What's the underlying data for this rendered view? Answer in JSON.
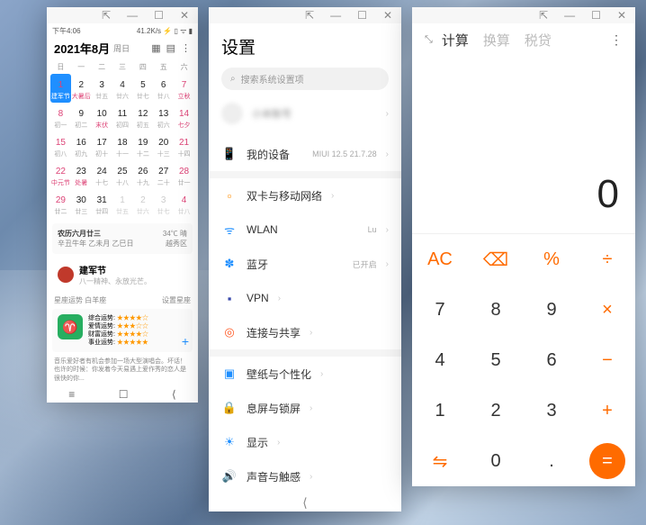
{
  "titlebar": {
    "pin": "⇱",
    "min": "—",
    "max": "☐",
    "close": "✕"
  },
  "calendar": {
    "status": {
      "time": "下午4:06",
      "signal": "41.2K/s ⚡ ▯ ᯤ ▮"
    },
    "title": "2021年8月",
    "sub": "周日",
    "dows": [
      "日",
      "一",
      "二",
      "三",
      "四",
      "五",
      "六"
    ],
    "days": [
      {
        "d": 1,
        "l": "建军节",
        "sel": true
      },
      {
        "d": 2,
        "l": "大暑后",
        "hol": true
      },
      {
        "d": 3,
        "l": "廿五"
      },
      {
        "d": 4,
        "l": "廿六"
      },
      {
        "d": 5,
        "l": "廿七"
      },
      {
        "d": 6,
        "l": "廿八"
      },
      {
        "d": 7,
        "l": "立秋",
        "hol": true
      },
      {
        "d": 8,
        "l": "初一"
      },
      {
        "d": 9,
        "l": "初二"
      },
      {
        "d": 10,
        "l": "末伏",
        "hol": true
      },
      {
        "d": 11,
        "l": "初四"
      },
      {
        "d": 12,
        "l": "初五"
      },
      {
        "d": 13,
        "l": "初六"
      },
      {
        "d": 14,
        "l": "七夕",
        "hol": true
      },
      {
        "d": 15,
        "l": "初八"
      },
      {
        "d": 16,
        "l": "初九"
      },
      {
        "d": 17,
        "l": "初十"
      },
      {
        "d": 18,
        "l": "十一"
      },
      {
        "d": 19,
        "l": "十二"
      },
      {
        "d": 20,
        "l": "十三"
      },
      {
        "d": 21,
        "l": "十四"
      },
      {
        "d": 22,
        "l": "中元节",
        "hol": true
      },
      {
        "d": 23,
        "l": "处暑",
        "hol": true
      },
      {
        "d": 24,
        "l": "十七"
      },
      {
        "d": 25,
        "l": "十八"
      },
      {
        "d": 26,
        "l": "十九"
      },
      {
        "d": 27,
        "l": "二十"
      },
      {
        "d": 28,
        "l": "廿一"
      },
      {
        "d": 29,
        "l": "廿二"
      },
      {
        "d": 30,
        "l": "廿三"
      },
      {
        "d": 31,
        "l": "廿四"
      },
      {
        "d": 1,
        "l": "廿五",
        "off": true
      },
      {
        "d": 2,
        "l": "廿六",
        "off": true
      },
      {
        "d": 3,
        "l": "廿七",
        "off": true
      },
      {
        "d": 4,
        "l": "廿八",
        "off": true
      }
    ],
    "info": {
      "lunar": "农历六月廿三",
      "line2": "辛丑牛年 乙未月 乙巳日",
      "temp": "34℃ 晴",
      "loc": "越秀区"
    },
    "festival": {
      "name": "建军节",
      "desc": "八一精神、永放光芒。"
    },
    "horoscope": {
      "header": "星座运势",
      "header2": "白羊座",
      "btn": "设置星座",
      "zodiac": "♈",
      "rows": [
        {
          "k": "综合运势:",
          "v": "★★★★☆"
        },
        {
          "k": "爱情运势:",
          "v": "★★★☆☆"
        },
        {
          "k": "财富运势:",
          "v": "★★★★☆"
        },
        {
          "k": "事业运势:",
          "v": "★★★★★"
        }
      ],
      "desc": "音乐爱好者有机会参加一场大型演唱会。坏话！也许的时候：你发着今天易遇上爱作秀的恋人是很快的你..."
    }
  },
  "settings": {
    "title": "设置",
    "search_ph": "搜索系统设置项",
    "user": "小米账号",
    "items": [
      {
        "ico": "📱",
        "c": "#1f8fff",
        "name": "我的设备",
        "val": "MIUI 12.5 21.7.28"
      },
      null,
      {
        "ico": "▫",
        "c": "#ff8c00",
        "name": "双卡与移动网络"
      },
      {
        "ico": "ᯤ",
        "c": "#1f8fff",
        "name": "WLAN",
        "val": "Lu"
      },
      {
        "ico": "✽",
        "c": "#1f8fff",
        "name": "蓝牙",
        "val": "已开启"
      },
      {
        "ico": "▪",
        "c": "#3949ab",
        "name": "VPN"
      },
      {
        "ico": "◎",
        "c": "#ff5722",
        "name": "连接与共享"
      },
      null,
      {
        "ico": "▣",
        "c": "#1f8fff",
        "name": "壁纸与个性化"
      },
      {
        "ico": "🔒",
        "c": "#ff8c00",
        "name": "息屏与锁屏"
      },
      {
        "ico": "☀",
        "c": "#1f8fff",
        "name": "显示"
      },
      {
        "ico": "🔊",
        "c": "#4caf50",
        "name": "声音与触感"
      }
    ]
  },
  "calc": {
    "tabs": [
      "计算",
      "换算",
      "税贷"
    ],
    "display": "0",
    "keys": [
      {
        "t": "AC",
        "op": true
      },
      {
        "t": "⌫",
        "op": true
      },
      {
        "t": "%",
        "op": true
      },
      {
        "t": "÷",
        "op": true
      },
      {
        "t": "7"
      },
      {
        "t": "8"
      },
      {
        "t": "9"
      },
      {
        "t": "×",
        "op": true
      },
      {
        "t": "4"
      },
      {
        "t": "5"
      },
      {
        "t": "6"
      },
      {
        "t": "−",
        "op": true
      },
      {
        "t": "1"
      },
      {
        "t": "2"
      },
      {
        "t": "3"
      },
      {
        "t": "+",
        "op": true
      },
      {
        "t": "⇋",
        "op": true
      },
      {
        "t": "0"
      },
      {
        "t": "."
      },
      {
        "t": "=",
        "eq": true
      }
    ]
  }
}
